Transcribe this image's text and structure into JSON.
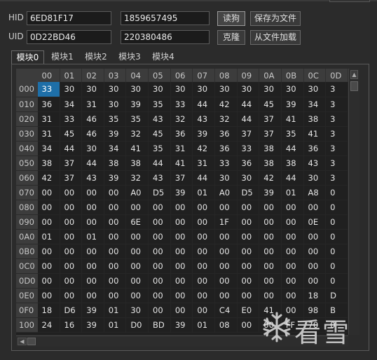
{
  "hid": {
    "label": "HID",
    "value": "6ED81F17",
    "number": "1859657495"
  },
  "uid": {
    "label": "UID",
    "value": "0D22BD46",
    "number": "220380486"
  },
  "buttons": {
    "read": "读狗",
    "save": "保存为文件",
    "clone": "克隆",
    "load": "从文件加载"
  },
  "tabs": [
    "模块0",
    "模块1",
    "模块2",
    "模块3",
    "模块4"
  ],
  "grid": {
    "columns": [
      "00",
      "01",
      "02",
      "03",
      "04",
      "05",
      "06",
      "07",
      "08",
      "09",
      "0A",
      "0B",
      "0C",
      "0D"
    ],
    "rows": [
      {
        "addr": "000",
        "cells": [
          "33",
          "30",
          "30",
          "30",
          "30",
          "30",
          "30",
          "30",
          "30",
          "30",
          "30",
          "30",
          "30",
          "3"
        ]
      },
      {
        "addr": "010",
        "cells": [
          "36",
          "34",
          "31",
          "30",
          "39",
          "35",
          "33",
          "44",
          "42",
          "44",
          "45",
          "39",
          "34",
          "3"
        ]
      },
      {
        "addr": "020",
        "cells": [
          "31",
          "33",
          "46",
          "35",
          "35",
          "43",
          "32",
          "43",
          "32",
          "44",
          "37",
          "41",
          "38",
          "3"
        ]
      },
      {
        "addr": "030",
        "cells": [
          "31",
          "45",
          "46",
          "39",
          "32",
          "45",
          "36",
          "39",
          "36",
          "37",
          "37",
          "35",
          "41",
          "3"
        ]
      },
      {
        "addr": "040",
        "cells": [
          "34",
          "44",
          "30",
          "34",
          "41",
          "35",
          "31",
          "42",
          "36",
          "33",
          "38",
          "44",
          "36",
          "3"
        ]
      },
      {
        "addr": "050",
        "cells": [
          "38",
          "37",
          "44",
          "38",
          "38",
          "44",
          "41",
          "31",
          "33",
          "36",
          "38",
          "38",
          "43",
          "3"
        ]
      },
      {
        "addr": "060",
        "cells": [
          "42",
          "37",
          "43",
          "39",
          "32",
          "43",
          "37",
          "44",
          "30",
          "30",
          "42",
          "44",
          "30",
          "3"
        ]
      },
      {
        "addr": "070",
        "cells": [
          "00",
          "00",
          "00",
          "00",
          "A0",
          "D5",
          "39",
          "01",
          "A0",
          "D5",
          "39",
          "01",
          "A8",
          "0"
        ]
      },
      {
        "addr": "080",
        "cells": [
          "00",
          "00",
          "00",
          "00",
          "00",
          "00",
          "00",
          "00",
          "00",
          "00",
          "00",
          "00",
          "00",
          "0"
        ]
      },
      {
        "addr": "090",
        "cells": [
          "00",
          "00",
          "00",
          "00",
          "6E",
          "00",
          "00",
          "00",
          "1F",
          "00",
          "00",
          "00",
          "0E",
          "0"
        ]
      },
      {
        "addr": "0A0",
        "cells": [
          "01",
          "00",
          "01",
          "00",
          "00",
          "00",
          "00",
          "00",
          "00",
          "00",
          "00",
          "00",
          "00",
          "0"
        ]
      },
      {
        "addr": "0B0",
        "cells": [
          "00",
          "00",
          "00",
          "00",
          "00",
          "00",
          "00",
          "00",
          "00",
          "00",
          "00",
          "00",
          "00",
          "0"
        ]
      },
      {
        "addr": "0C0",
        "cells": [
          "00",
          "00",
          "00",
          "00",
          "00",
          "00",
          "00",
          "00",
          "00",
          "00",
          "00",
          "00",
          "00",
          "0"
        ]
      },
      {
        "addr": "0D0",
        "cells": [
          "00",
          "00",
          "00",
          "00",
          "00",
          "00",
          "00",
          "00",
          "00",
          "00",
          "00",
          "00",
          "00",
          "0"
        ]
      },
      {
        "addr": "0E0",
        "cells": [
          "00",
          "00",
          "00",
          "00",
          "00",
          "00",
          "00",
          "00",
          "00",
          "00",
          "00",
          "00",
          "18",
          "D"
        ]
      },
      {
        "addr": "0F0",
        "cells": [
          "18",
          "D6",
          "39",
          "01",
          "30",
          "00",
          "00",
          "00",
          "C4",
          "E0",
          "41",
          "00",
          "98",
          "B"
        ]
      },
      {
        "addr": "100",
        "cells": [
          "24",
          "16",
          "39",
          "01",
          "D0",
          "BD",
          "39",
          "01",
          "08",
          "00",
          "00",
          "FF",
          "70",
          "0"
        ]
      }
    ],
    "selected": {
      "row": 0,
      "col": 0
    }
  },
  "watermark": "看雪",
  "icons": {
    "watermark": "snowflake-icon",
    "scroll_up": "arrow-up-icon",
    "scroll_down": "arrow-down-icon",
    "scroll_left": "arrow-left-icon",
    "scroll_right": "arrow-right-icon"
  }
}
